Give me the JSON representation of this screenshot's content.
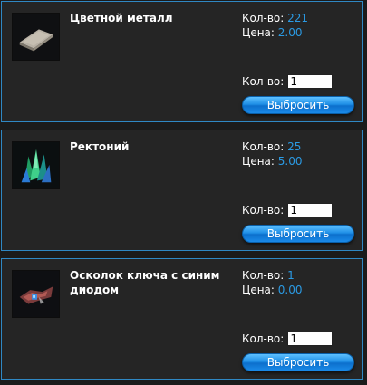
{
  "items": [
    {
      "name": "Цветной металл",
      "icon": "metal-ingot-icon",
      "qty_label": "Кол-во:",
      "qty_value": "221",
      "price_label": "Цена:",
      "price_value": "2.00",
      "input_label": "Кол-во:",
      "input_value": "1",
      "drop_label": "Выбросить"
    },
    {
      "name": "Ректоний",
      "icon": "green-crystal-icon",
      "qty_label": "Кол-во:",
      "qty_value": "25",
      "price_label": "Цена:",
      "price_value": "5.00",
      "input_label": "Кол-во:",
      "input_value": "1",
      "drop_label": "Выбросить"
    },
    {
      "name": "Осколок ключа с синим диодом",
      "icon": "key-shard-icon",
      "qty_label": "Кол-во:",
      "qty_value": "1",
      "price_label": "Цена:",
      "price_value": "0.00",
      "input_label": "Кол-во:",
      "input_value": "1",
      "drop_label": "Выбросить"
    }
  ],
  "colors": {
    "accent": "#2b9ae3",
    "border": "#2f88c4",
    "card_bg": "#252525"
  }
}
